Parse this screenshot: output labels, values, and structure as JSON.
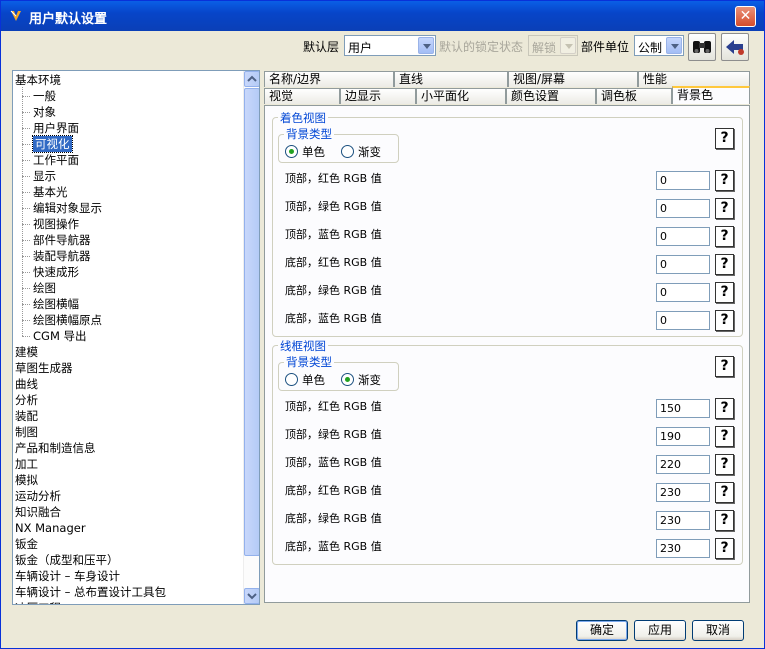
{
  "window": {
    "title": "用户默认设置",
    "close": "✕"
  },
  "toolbar": {
    "default_layer_label": "默认层",
    "default_layer_value": "用户",
    "lock_state_label": "默认的锁定状态",
    "lock_state_value": "解锁",
    "units_label": "部件单位",
    "units_value": "公制"
  },
  "tree": {
    "items": [
      "基本环境",
      "一般",
      "对象",
      "用户界面",
      "可视化",
      "工作平面",
      "显示",
      "基本光",
      "编辑对象显示",
      "视图操作",
      "部件导航器",
      "装配导航器",
      "快速成形",
      "绘图",
      "绘图横幅",
      "绘图横幅原点",
      "CGM 导出",
      "建模",
      "草图生成器",
      "曲线",
      "分析",
      "装配",
      "制图",
      "产品和制造信息",
      "加工",
      "模拟",
      "运动分析",
      "知识融合",
      "NX Manager",
      "钣金",
      "钣金（成型和压平）",
      "车辆设计 – 车身设计",
      "车辆设计 – 总布置设计工具包",
      "冲压工程"
    ],
    "selected": "可视化"
  },
  "tabs": {
    "row1": [
      "名称/边界",
      "直线",
      "视图/屏幕",
      "性能"
    ],
    "row2": [
      "视觉",
      "边显示",
      "小平面化",
      "颜色设置",
      "调色板",
      "背景色"
    ],
    "active": "背景色"
  },
  "shaded": {
    "title": "着色视图",
    "bg_type_title": "背景类型",
    "opt1": "单色",
    "opt2": "渐变",
    "selected": "单色",
    "rows": [
      {
        "label": "顶部，红色 RGB 值",
        "value": "0"
      },
      {
        "label": "顶部，绿色 RGB 值",
        "value": "0"
      },
      {
        "label": "顶部，蓝色 RGB 值",
        "value": "0"
      },
      {
        "label": "底部，红色 RGB 值",
        "value": "0"
      },
      {
        "label": "底部，绿色 RGB 值",
        "value": "0"
      },
      {
        "label": "底部，蓝色 RGB 值",
        "value": "0"
      }
    ]
  },
  "wireframe": {
    "title": "线框视图",
    "bg_type_title": "背景类型",
    "opt1": "单色",
    "opt2": "渐变",
    "selected": "渐变",
    "rows": [
      {
        "label": "顶部，红色 RGB 值",
        "value": "150"
      },
      {
        "label": "顶部，绿色 RGB 值",
        "value": "190"
      },
      {
        "label": "顶部，蓝色 RGB 值",
        "value": "220"
      },
      {
        "label": "底部，红色 RGB 值",
        "value": "230"
      },
      {
        "label": "底部，绿色 RGB 值",
        "value": "230"
      },
      {
        "label": "底部，蓝色 RGB 值",
        "value": "230"
      }
    ]
  },
  "help_glyph": "?",
  "buttons": {
    "ok": "确定",
    "apply": "应用",
    "cancel": "取消"
  },
  "icons": {
    "app": "nx-icon",
    "find": "binoculars-icon",
    "back": "back-arrow-icon"
  }
}
